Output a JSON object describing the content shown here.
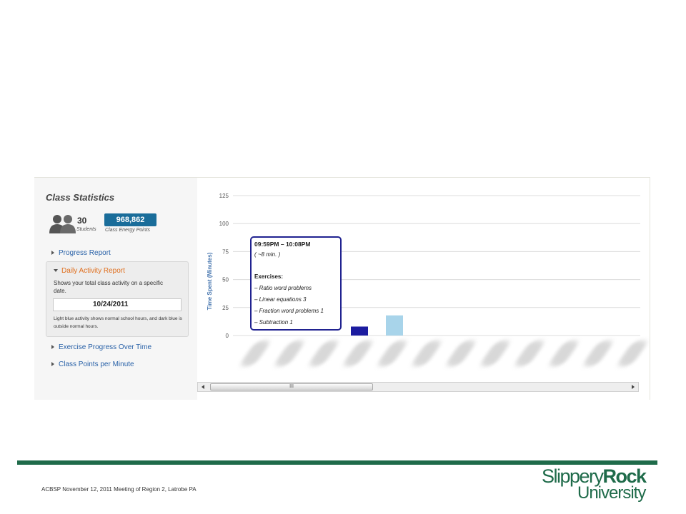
{
  "sidebar": {
    "title": "Class Statistics",
    "students_count": "30",
    "students_label": "Students",
    "points_value": "968,862",
    "points_label": "Class Energy Points",
    "nav": [
      {
        "label": "Progress Report"
      },
      {
        "label": "Daily Activity Report"
      },
      {
        "label": "Exercise Progress Over Time"
      },
      {
        "label": "Class Points per Minute"
      }
    ],
    "active": {
      "description": "Shows your total class activity on a specific date.",
      "date": "10/24/2011",
      "note": "Light blue activity shows normal school hours, and dark blue is outside normal hours."
    }
  },
  "chart_data": {
    "type": "bar",
    "ylabel": "Time Spent (Minutes)",
    "ylim": [
      0,
      125
    ],
    "yticks": [
      0,
      25,
      50,
      75,
      100,
      125
    ],
    "grid": true,
    "series": [
      {
        "values": [
          8
        ],
        "color": "#1c1ca0",
        "slot": 3
      },
      {
        "values": [
          18
        ],
        "color": "#a8d4ea",
        "slot": 4
      }
    ]
  },
  "tooltip": {
    "time_range": "09:59PM  –  10:08PM",
    "duration": "( ~8 min. )",
    "exercises_label": "Exercises:",
    "items": [
      "–  Ratio word problems",
      "–  Linear equations 3",
      "–  Fraction word problems 1",
      "–  Subtraction 1"
    ]
  },
  "scrollbar": {
    "thumb_label": "III"
  },
  "footer": {
    "text": "ACBSP November 12, 2011 Meeting of Region 2, Latrobe PA",
    "logo_part1": "Slippery",
    "logo_part2": "Rock",
    "logo_part3": "University",
    "brand_color": "#1f6b4a"
  }
}
